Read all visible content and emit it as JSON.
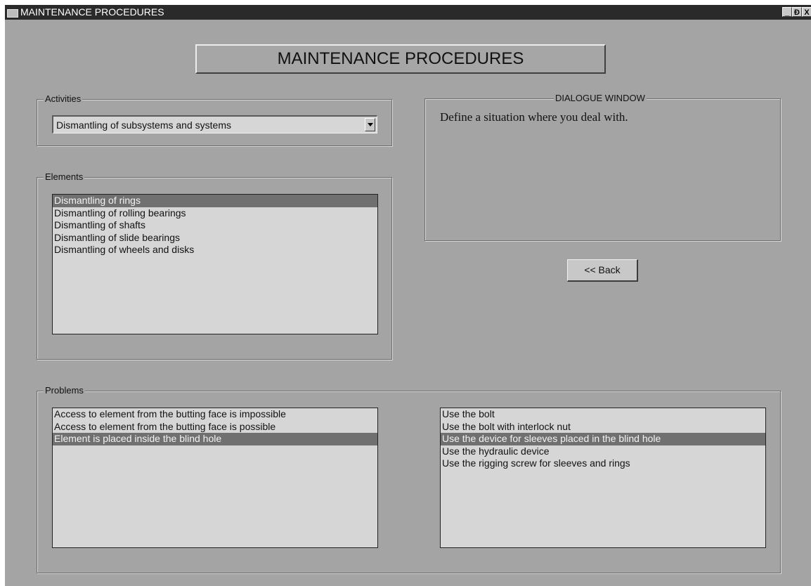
{
  "window": {
    "title": "MAINTENANCE PROCEDURES",
    "controls": {
      "minimize": "_",
      "restore": "Ɖ",
      "close": "X"
    }
  },
  "heading": "MAINTENANCE PROCEDURES",
  "activities": {
    "label": "Activities",
    "selected": "Dismantling of subsystems and systems"
  },
  "elements": {
    "label": "Elements",
    "items": [
      "Dismantling of rings",
      "Dismantling of rolling bearings",
      "Dismantling of shafts",
      "Dismantling of slide bearings",
      "Dismantling of wheels and disks"
    ],
    "selected_index": 0
  },
  "dialogue": {
    "label": "DIALOGUE WINDOW",
    "text": "Define a situation where you deal with."
  },
  "back_button": "<< Back",
  "problems": {
    "label": "Problems",
    "situations": {
      "items": [
        "Access to element from the butting face is impossible",
        "Access to element from the butting face is possible",
        "Element is placed inside the blind hole"
      ],
      "selected_index": 2
    },
    "solutions": {
      "items": [
        "Use the bolt",
        "Use the bolt with interlock nut",
        "Use the device for sleeves placed in the blind hole",
        "Use the hydraulic device",
        "Use the rigging screw for sleeves and rings"
      ],
      "selected_index": 2
    }
  },
  "colors": {
    "background": "#a4a4a4",
    "titlebar": "#2a2a2a",
    "list_background": "#d6d6d6",
    "selection": "#707070"
  }
}
